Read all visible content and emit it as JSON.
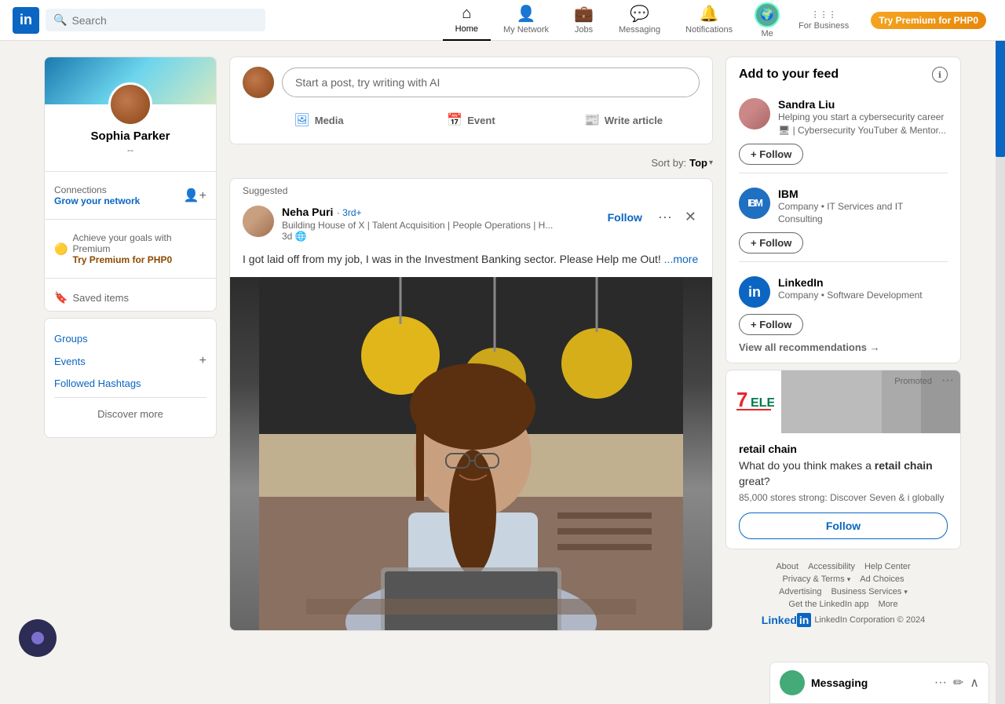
{
  "topbar": {
    "logo": "in",
    "search_placeholder": "Search",
    "nav": [
      {
        "id": "home",
        "label": "Home",
        "icon": "⌂",
        "active": true
      },
      {
        "id": "my-network",
        "label": "My Network",
        "icon": "👤"
      },
      {
        "id": "jobs",
        "label": "Jobs",
        "icon": "💼"
      },
      {
        "id": "messaging",
        "label": "Messaging",
        "icon": "💬"
      },
      {
        "id": "notifications",
        "label": "Notifications",
        "icon": "🔔"
      },
      {
        "id": "me",
        "label": "Me",
        "icon": "▾"
      },
      {
        "id": "for-business",
        "label": "For Business",
        "icon": "⋮⋮⋮",
        "has_dropdown": true
      }
    ],
    "premium_label": "Try Premium for PHP0"
  },
  "sidebar_left": {
    "profile": {
      "name": "Sophia Parker",
      "dash": "--"
    },
    "connections": {
      "label": "Connections",
      "sub_label": "Grow your network"
    },
    "premium": {
      "label": "Achieve your goals with Premium",
      "link_label": "Try Premium for PHP0"
    },
    "saved_items": "Saved items",
    "nav_items": [
      {
        "label": "Groups",
        "has_plus": false
      },
      {
        "label": "Events",
        "has_plus": true
      },
      {
        "label": "Followed Hashtags",
        "has_plus": false
      }
    ],
    "discover_more": "Discover more"
  },
  "feed": {
    "post_placeholder": "Start a post, try writing with AI",
    "actions": [
      {
        "id": "media",
        "label": "Media",
        "icon": "🖼"
      },
      {
        "id": "event",
        "label": "Event",
        "icon": "📅"
      },
      {
        "id": "article",
        "label": "Write article",
        "icon": "📰"
      }
    ],
    "sort_label": "Sort by:",
    "sort_value": "Top",
    "posts": [
      {
        "id": "post-1",
        "suggested_label": "Suggested",
        "author_name": "Neha Puri",
        "author_badge": "3rd+",
        "author_title": "Building House of X | Talent Acquisition | People Operations | H...",
        "time": "3d",
        "follow_label": "Follow",
        "text": "I got laid off from my job, I was in the Investment Banking sector. Please Help me Out!",
        "more_label": "...more",
        "has_image": true
      }
    ]
  },
  "sidebar_right": {
    "feed_widget": {
      "title": "Add to your feed",
      "people": [
        {
          "id": "sandra",
          "name": "Sandra Liu",
          "desc": "Helping you start a cybersecurity career\n🖥 | Cybersecurity YouTuber & Mentor...",
          "follow_label": "+ Follow"
        },
        {
          "id": "ibm",
          "name": "IBM",
          "desc": "Company • IT Services and IT Consulting",
          "follow_label": "+ Follow",
          "is_company": true,
          "company_type": "ibm"
        },
        {
          "id": "linkedin",
          "name": "LinkedIn",
          "desc": "Company • Software Development",
          "follow_label": "+ Follow",
          "is_company": true,
          "company_type": "linkedin"
        }
      ],
      "view_all_label": "View all recommendations →"
    },
    "ad": {
      "company": "retail chain",
      "promoted_label": "Promoted",
      "headline": "What do you think makes a",
      "headline_bold": "retail chain",
      "headline_end": "great?",
      "sub": "85,000 stores strong: Discover Seven & i globally",
      "follow_label": "Follow"
    },
    "footer": {
      "links": [
        "About",
        "Accessibility",
        "Help Center",
        "Privacy & Terms",
        "Ad Choices",
        "Advertising",
        "Business Services",
        "Get the LinkedIn app",
        "More"
      ],
      "brand": "LinkedIn",
      "copyright": "LinkedIn Corporation © 2024"
    }
  },
  "messaging": {
    "title": "Messaging",
    "actions": [
      "···",
      "✏",
      "∧"
    ]
  },
  "icons": {
    "search": "🔍",
    "add_connection": "👤+",
    "bookmark": "🔖",
    "globe": "🌐",
    "chevron_down": "▾",
    "chevron_right": "›",
    "more": "•••",
    "close": "✕",
    "plus": "+"
  }
}
